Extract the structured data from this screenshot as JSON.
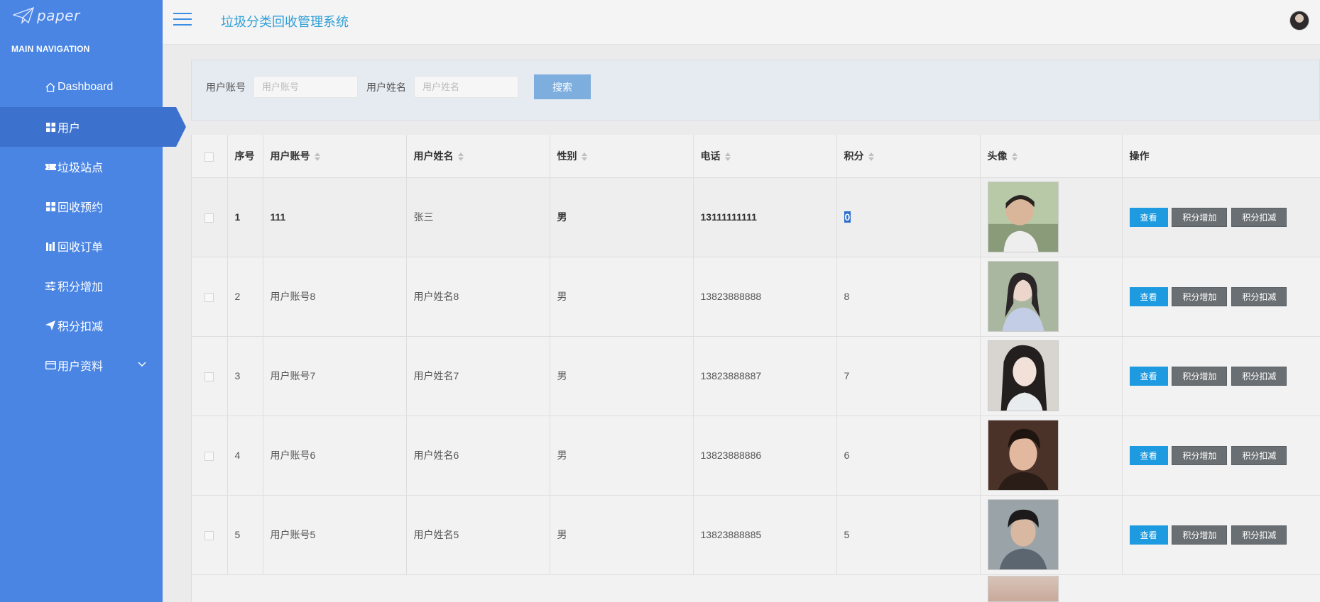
{
  "brand": {
    "logo_text": "paper"
  },
  "sidebar": {
    "heading": "MAIN NAVIGATION",
    "items": [
      {
        "label": "Dashboard",
        "icon": "home-icon"
      },
      {
        "label": "用户",
        "icon": "grid-icon",
        "active": true
      },
      {
        "label": "垃圾站点",
        "icon": "ticket-icon"
      },
      {
        "label": "回收预约",
        "icon": "grid-icon"
      },
      {
        "label": "回收订单",
        "icon": "bars-icon"
      },
      {
        "label": "积分增加",
        "icon": "sliders-icon"
      },
      {
        "label": "积分扣减",
        "icon": "send-icon"
      },
      {
        "label": "用户资料",
        "icon": "card-icon",
        "expandable": true
      }
    ]
  },
  "header": {
    "title": "垃圾分类回收管理系统"
  },
  "search": {
    "account_label": "用户账号",
    "account_placeholder": "用户账号",
    "name_label": "用户姓名",
    "name_placeholder": "用户姓名",
    "button_label": "搜索"
  },
  "table": {
    "columns": [
      "序号",
      "用户账号",
      "用户姓名",
      "性别",
      "电话",
      "积分",
      "头像",
      "操作"
    ],
    "actions": {
      "view": "查看",
      "add_points": "积分增加",
      "deduct_points": "积分扣减"
    },
    "rows": [
      {
        "index": "1",
        "account": "111",
        "name": "张三",
        "gender": "男",
        "phone": "13111111111",
        "points": "0"
      },
      {
        "index": "2",
        "account": "用户账号8",
        "name": "用户姓名8",
        "gender": "男",
        "phone": "13823888888",
        "points": "8"
      },
      {
        "index": "3",
        "account": "用户账号7",
        "name": "用户姓名7",
        "gender": "男",
        "phone": "13823888887",
        "points": "7"
      },
      {
        "index": "4",
        "account": "用户账号6",
        "name": "用户姓名6",
        "gender": "男",
        "phone": "13823888886",
        "points": "6"
      },
      {
        "index": "5",
        "account": "用户账号5",
        "name": "用户姓名5",
        "gender": "男",
        "phone": "13823888885",
        "points": "5"
      }
    ]
  },
  "colors": {
    "sidebar_bg": "#4a85e4",
    "sidebar_active": "#3c72cd",
    "title_color": "#2f9fd8",
    "view_button": "#1e9be0",
    "gray_button": "#6a6f73",
    "search_button": "#7eaede"
  }
}
